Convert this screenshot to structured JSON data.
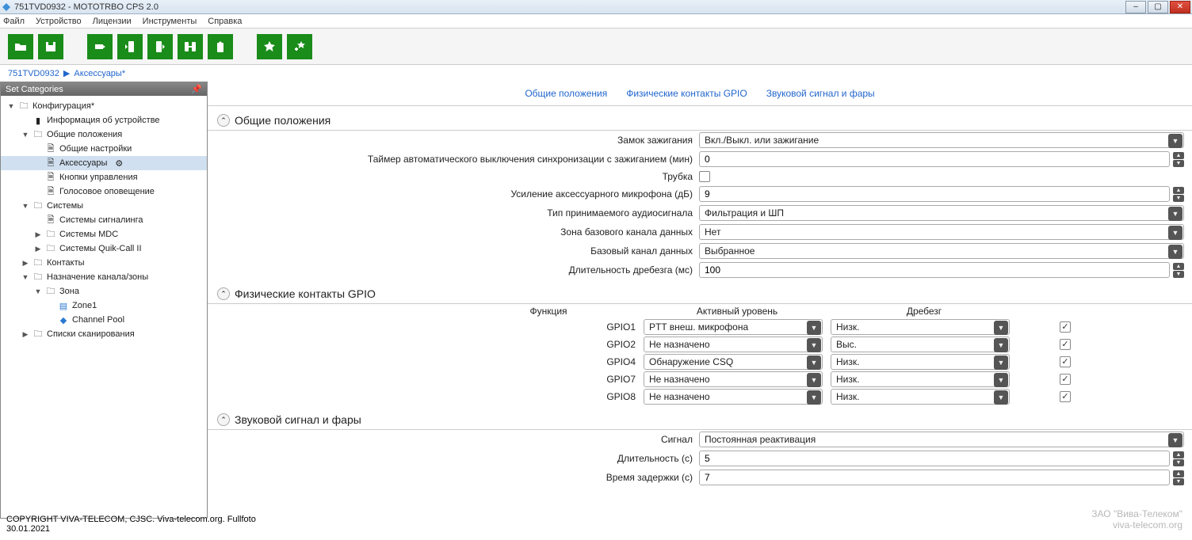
{
  "window": {
    "title": "751TVD0932 - MOTOTRBO CPS 2.0"
  },
  "menu": {
    "file": "Файл",
    "device": "Устройство",
    "licenses": "Лицензии",
    "tools": "Инструменты",
    "help": "Справка"
  },
  "breadcrumb": {
    "root": "751TVD0932",
    "current": "Аксессуары*"
  },
  "sidebar": {
    "header": "Set Categories",
    "items": {
      "config": "Конфигурация*",
      "device_info": "Информация об устройстве",
      "general": "Общие положения",
      "general_settings": "Общие настройки",
      "accessories": "Аксессуары",
      "buttons": "Кнопки управления",
      "voice": "Голосовое оповещение",
      "systems": "Системы",
      "signaling": "Системы сигналинга",
      "mdc": "Системы MDC",
      "quikcall": "Системы Quik-Call II",
      "contacts": "Контакты",
      "channel_assign": "Назначение канала/зоны",
      "zone": "Зона",
      "zone1": "Zone1",
      "channel_pool": "Channel Pool",
      "scanlists": "Списки сканирования"
    }
  },
  "tabs": {
    "general": "Общие положения",
    "gpio": "Физические контакты GPIO",
    "horn": "Звуковой сигнал и фары"
  },
  "sec_general": {
    "title": "Общие положения",
    "ignition_label": "Замок зажигания",
    "ignition_value": "Вкл./Выкл. или зажигание",
    "timer_label": "Таймер автоматического выключения синхронизации с зажиганием (мин)",
    "timer_value": "0",
    "hook_label": "Трубка",
    "micgain_label": "Усиление аксессуарного микрофона (дБ)",
    "micgain_value": "9",
    "audiotype_label": "Тип принимаемого аудиосигнала",
    "audiotype_value": "Фильтрация и ШП",
    "basezone_label": "Зона базового канала данных",
    "basezone_value": "Нет",
    "basechan_label": "Базовый канал данных",
    "basechan_value": "Выбранное",
    "debounce_label": "Длительность дребезга (мс)",
    "debounce_value": "100"
  },
  "sec_gpio": {
    "title": "Физические контакты GPIO",
    "col_func": "Функция",
    "col_level": "Активный уровень",
    "col_debounce": "Дребезг",
    "rows": [
      {
        "pin": "GPIO1",
        "func": "PTT внеш. микрофона",
        "level": "Низк.",
        "deb": true
      },
      {
        "pin": "GPIO2",
        "func": "Не назначено",
        "level": "Выс.",
        "deb": true
      },
      {
        "pin": "GPIO4",
        "func": "Обнаружение CSQ",
        "level": "Низк.",
        "deb": true
      },
      {
        "pin": "GPIO7",
        "func": "Не назначено",
        "level": "Низк.",
        "deb": true
      },
      {
        "pin": "GPIO8",
        "func": "Не назначено",
        "level": "Низк.",
        "deb": true
      }
    ]
  },
  "sec_horn": {
    "title": "Звуковой сигнал и фары",
    "signal_label": "Сигнал",
    "signal_value": "Постоянная реактивация",
    "duration_label": "Длительность (с)",
    "duration_value": "5",
    "delay_label": "Время задержки (с)",
    "delay_value": "7"
  },
  "copyright": {
    "l1": "COPYRIGHT VIVA-TELECOM, CJSC. Viva-telecom.org. Fullfoto",
    "l2": "30.01.2021"
  },
  "watermark": {
    "l1": "ЗАО \"Вива-Телеком\"",
    "l2": "viva-telecom.org"
  }
}
